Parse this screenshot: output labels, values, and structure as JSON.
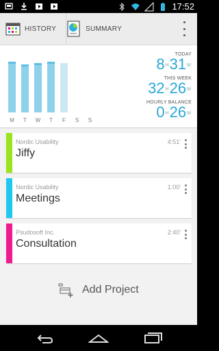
{
  "status_bar": {
    "time": "17:52",
    "left_icons": [
      "usb-debug-icon",
      "download-icon",
      "play-store-icon",
      "play-store-icon"
    ],
    "right_icons": [
      "bluetooth-icon",
      "wifi-icon",
      "signal-icon",
      "battery-icon"
    ]
  },
  "action_bar": {
    "history_label": "HISTORY",
    "summary_label": "SUMMARY"
  },
  "week": {
    "days": [
      {
        "label": "M",
        "level": 0.9
      },
      {
        "label": "T",
        "level": 0.85
      },
      {
        "label": "W",
        "level": 0.88
      },
      {
        "label": "T",
        "level": 0.9
      },
      {
        "label": "F",
        "level": 0.88
      },
      {
        "label": "S",
        "level": 0
      },
      {
        "label": "S",
        "level": 0
      }
    ]
  },
  "stats": {
    "today_label": "TODAY",
    "today_h": "8",
    "today_m": "31",
    "week_label": "THIS WEEK",
    "week_h": "32",
    "week_m": "26",
    "balance_label": "HOURLY BALANCE",
    "balance_h": "0",
    "balance_m": "26",
    "unit_h": "H",
    "unit_m": "M"
  },
  "projects": [
    {
      "client": "Nordic Usability",
      "name": "Jiffy",
      "time": "4:51'",
      "color": "#9be31c"
    },
    {
      "client": "Nordic Usability",
      "name": "Meetings",
      "time": "1:00'",
      "color": "#1ec8ef"
    },
    {
      "client": "Psudosoft Inc.",
      "name": "Consultation",
      "time": "2:40'",
      "color": "#ee1c8f"
    }
  ],
  "add_project_label": "Add Project"
}
